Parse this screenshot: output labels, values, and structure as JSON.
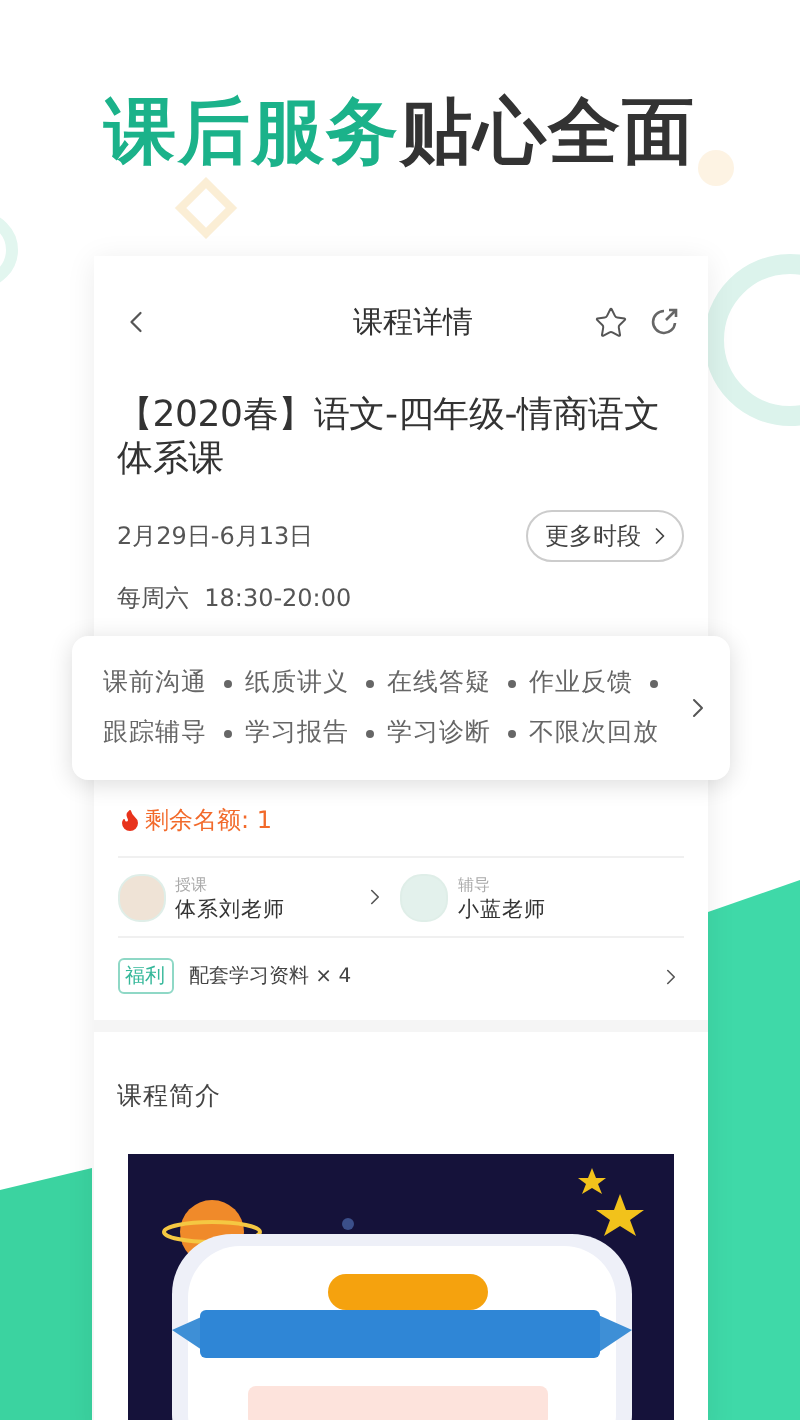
{
  "headline": {
    "highlight": "课后服务",
    "rest": "贴心全面"
  },
  "nav": {
    "title": "课程详情"
  },
  "course": {
    "title": "【2020春】语文-四年级-情商语文体系课",
    "dates": "2月29日-6月13日",
    "more_button": "更多时段",
    "schedule": "每周六  18:30-20:00"
  },
  "services": [
    "课前沟通",
    "纸质讲义",
    "在线答疑",
    "作业反馈",
    "跟踪辅导",
    "学习报告",
    "学习诊断",
    "不限次回放"
  ],
  "remaining": "剩余名额: 1",
  "teachers": [
    {
      "role": "授课",
      "name": "体系刘老师"
    },
    {
      "role": "辅导",
      "name": "小蓝老师"
    }
  ],
  "welfare": {
    "tag": "福利",
    "text": "配套学习资料 × 4"
  },
  "intro": {
    "title": "课程简介"
  }
}
